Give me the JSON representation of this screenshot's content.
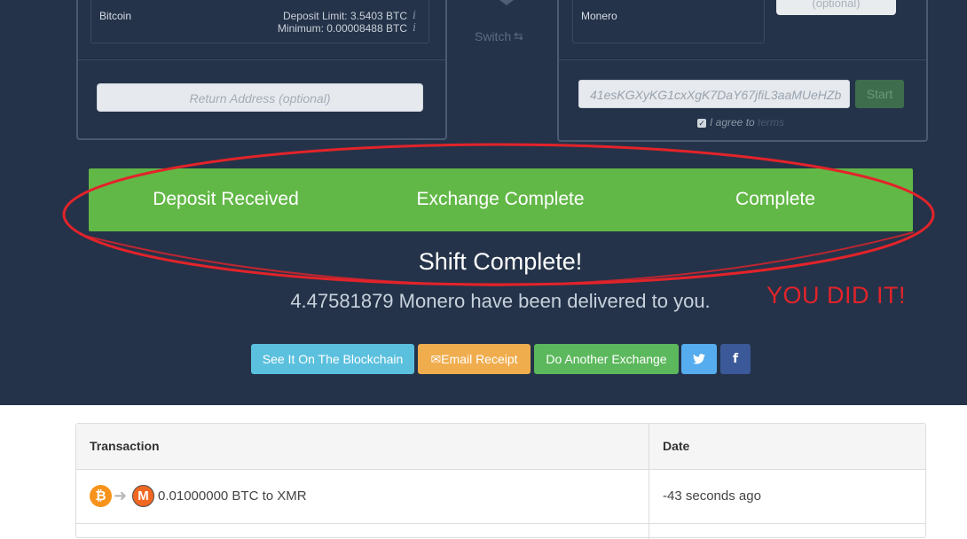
{
  "exchange": {
    "deposit_coin": "Bitcoin",
    "deposit_limit": "Deposit Limit: 3.5403 BTC",
    "minimum": "Minimum: 0.00008488 BTC",
    "info_glyph": "i",
    "switch_label": "Switch",
    "switch_icon": "⇆",
    "receive_coin": "Monero",
    "optional_label": "(optional)",
    "return_address_placeholder": "Return Address (optional)",
    "withdrawal_address": "41esKGXyKG1cxXgK7DaY67jfiL3aaMUeHZb",
    "start_label": "Start",
    "agree_text": "I agree to",
    "terms_link": "terms"
  },
  "status": {
    "steps": [
      "Deposit Received",
      "Exchange Complete",
      "Complete"
    ],
    "title": "Shift Complete!",
    "delivered_text": "4.47581879 Monero have been delivered to you."
  },
  "annotation": {
    "text": "YOU DID IT!",
    "color": "#e3232a"
  },
  "actions": {
    "blockchain_label": "See It On The Blockchain",
    "email_label": "Email Receipt",
    "email_icon": "✉",
    "another_label": "Do Another Exchange",
    "twitter_icon": "twitter-icon",
    "facebook_icon": "facebook-icon"
  },
  "transactions": {
    "headers": [
      "Transaction",
      "Date"
    ],
    "rows": [
      {
        "from_icon": "bitcoin-icon",
        "to_icon": "monero-icon",
        "description": "0.01000000 BTC to XMR",
        "date": "-43 seconds ago"
      }
    ]
  },
  "colors": {
    "hero_background": "#243349",
    "status_green": "#62b847",
    "blockchain_btn": "#5bc0de",
    "email_btn": "#f0ad4e",
    "another_btn": "#5cb85c",
    "twitter_btn": "#55acee",
    "facebook_btn": "#3b5998"
  }
}
